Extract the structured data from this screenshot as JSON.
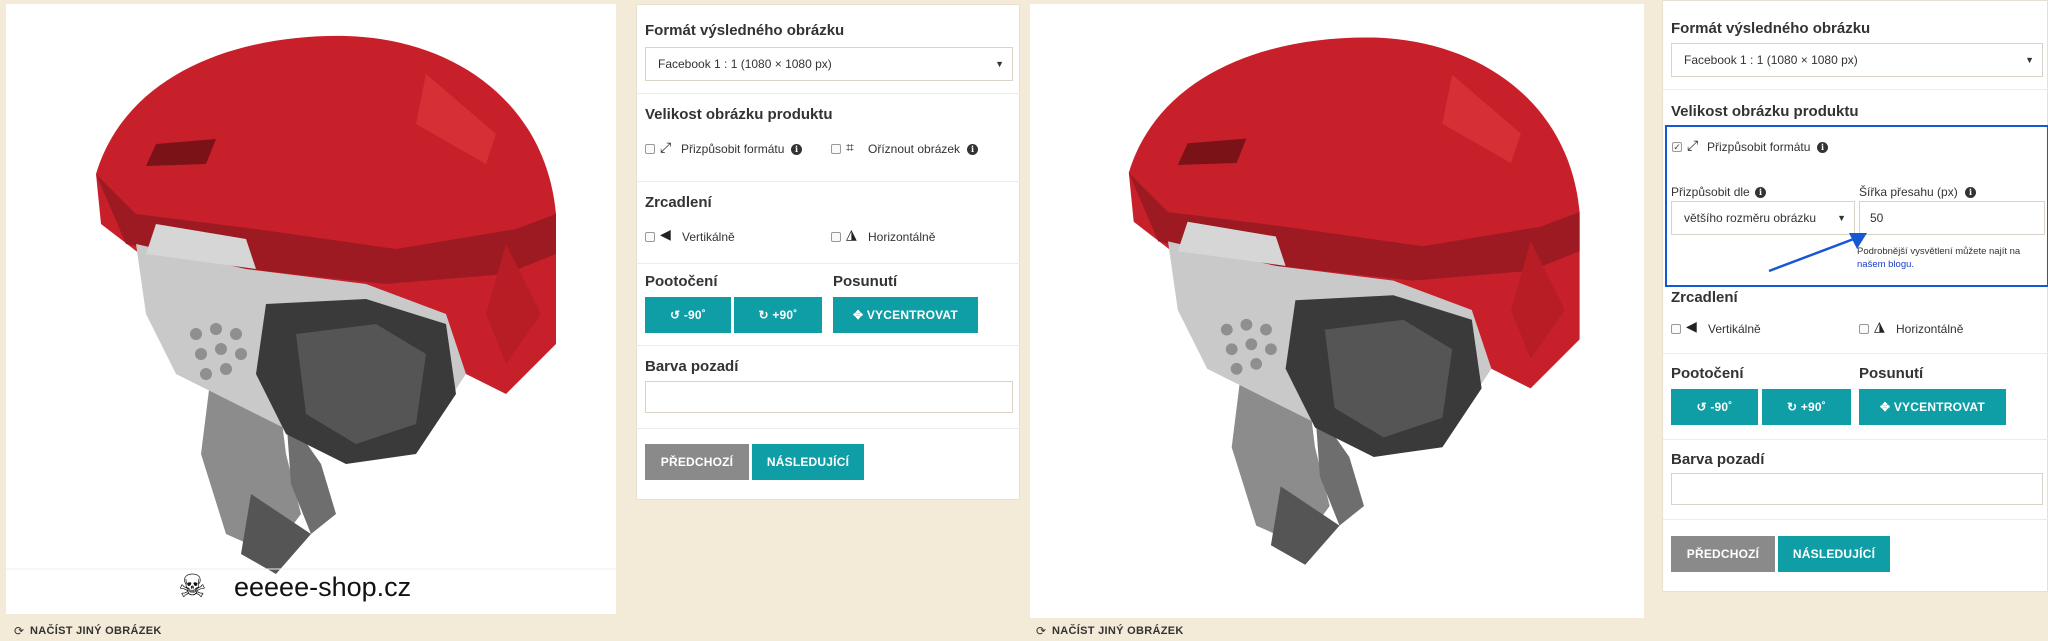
{
  "left": {
    "footer_brand": "eeeee-shop.cz",
    "load_image_link": "NAČÍST JINÝ OBRÁZEK",
    "format_title": "Formát výsledného obrázku",
    "format_value": "Facebook 1 : 1 (1080 × 1080 px)",
    "size_title": "Velikost obrázku produktu",
    "fit_label": "Přizpůsobit formátu",
    "crop_label": "Oříznout obrázek",
    "mirror_title": "Zrcadlení",
    "vertical_label": "Vertikálně",
    "horizontal_label": "Horizontálně",
    "rotation_title": "Pootočení",
    "shift_title": "Posunutí",
    "rotate_left": "-90˚",
    "rotate_right": "+90˚",
    "center_label": "VYCENTROVAT",
    "bg_title": "Barva pozadí",
    "prev_label": "PŘEDCHOZÍ",
    "next_label": "NÁSLEDUJÍCÍ"
  },
  "right": {
    "load_image_link": "NAČÍST JINÝ OBRÁZEK",
    "format_title": "Formát výsledného obrázku",
    "format_value": "Facebook 1 : 1 (1080 × 1080 px)",
    "size_title": "Velikost obrázku produktu",
    "fit_label": "Přizpůsobit formátu",
    "fit_by_label": "Přizpůsobit dle",
    "fit_by_value": "většího rozměru obrázku",
    "overlap_label": "Šířka přesahu (px)",
    "overlap_value": "50",
    "hint_text": "Podrobnější vysvětlení můžete najít na",
    "hint_link": "našem blogu.",
    "mirror_title": "Zrcadlení",
    "vertical_label": "Vertikálně",
    "horizontal_label": "Horizontálně",
    "rotation_title": "Pootočení",
    "shift_title": "Posunutí",
    "rotate_left": "-90˚",
    "rotate_right": "+90˚",
    "center_label": "VYCENTROVAT",
    "bg_title": "Barva pozadí",
    "prev_label": "PŘEDCHOZÍ",
    "next_label": "NÁSLEDUJÍCÍ"
  },
  "colors": {
    "accent_teal": "#0f9ea6",
    "button_gray": "#8a8a8a",
    "page_bg": "#f3ead7",
    "highlight_blue": "#1558d6",
    "helmet_red": "#c8202a"
  },
  "icons": {
    "refresh": "refresh-icon",
    "expand": "expand-arrows-icon",
    "crop": "crop-icon",
    "info": "info-icon",
    "flip_vertical": "flip-vertical-icon",
    "flip_horizontal": "flip-horizontal-icon",
    "rotate_ccw": "rotate-ccw-icon",
    "rotate_cw": "rotate-cw-icon",
    "center": "center-arrows-icon",
    "skull": "skull-icon"
  }
}
